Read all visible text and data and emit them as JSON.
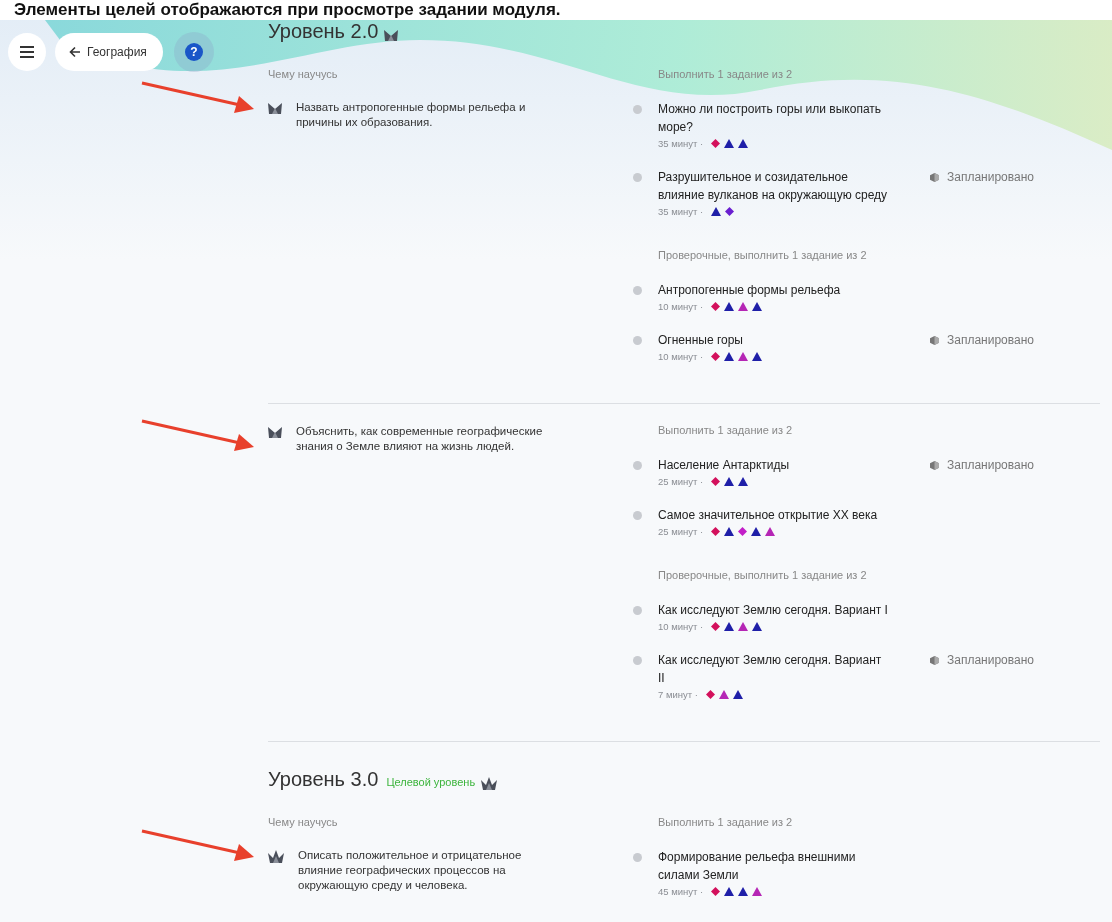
{
  "caption": "Элементы целей отображаются при просмотре задании модуля.",
  "nav": {
    "back_label": "География",
    "help_label": "?"
  },
  "levels": [
    {
      "title": "Уровень 2.0",
      "kind": "two-peak",
      "goals_heading": "Чему научусь",
      "goals": [
        {
          "text": "Назвать антропогенные формы рельефа и причины их образования.",
          "arrowed": true,
          "groups": [
            {
              "heading": "Выполнить 1 задание из 2",
              "tasks": [
                {
                  "title": "Можно ли построить горы или выкопать море?",
                  "duration": "35 минут ·",
                  "marks": [
                    {
                      "kind": "diamond",
                      "color": "#d3105c"
                    },
                    {
                      "kind": "triangle",
                      "color": "#1f1fa8"
                    },
                    {
                      "kind": "triangle",
                      "color": "#1f1fa8"
                    }
                  ]
                },
                {
                  "title": "Разрушительное и созидательное влияние вулканов на окружающую среду",
                  "duration": "35 минут ·",
                  "status": "Запланировано",
                  "marks": [
                    {
                      "kind": "triangle",
                      "color": "#1f1fa8"
                    },
                    {
                      "kind": "diamond",
                      "color": "#6a1fd0"
                    }
                  ]
                }
              ]
            },
            {
              "heading": "Проверочные, выполнить 1 задание из 2",
              "tasks": [
                {
                  "title": "Антропогенные формы рельефа",
                  "duration": "10 минут ·",
                  "marks": [
                    {
                      "kind": "diamond",
                      "color": "#d3105c"
                    },
                    {
                      "kind": "triangle",
                      "color": "#1f1fa8"
                    },
                    {
                      "kind": "triangle",
                      "color": "#b526b5"
                    },
                    {
                      "kind": "triangle",
                      "color": "#1f1fa8"
                    }
                  ]
                },
                {
                  "title": "Огненные горы",
                  "duration": "10 минут ·",
                  "status": "Запланировано",
                  "marks": [
                    {
                      "kind": "diamond",
                      "color": "#d3105c"
                    },
                    {
                      "kind": "triangle",
                      "color": "#1f1fa8"
                    },
                    {
                      "kind": "triangle",
                      "color": "#b526b5"
                    },
                    {
                      "kind": "triangle",
                      "color": "#1f1fa8"
                    }
                  ]
                }
              ]
            }
          ]
        },
        {
          "text": "Объяснить, как современные географические знания о Земле влияют на жизнь людей.",
          "arrowed": true,
          "groups": [
            {
              "heading": "Выполнить 1 задание из 2",
              "tasks": [
                {
                  "title": "Население Антарктиды",
                  "duration": "25 минут ·",
                  "status": "Запланировано",
                  "marks": [
                    {
                      "kind": "diamond",
                      "color": "#d3105c"
                    },
                    {
                      "kind": "triangle",
                      "color": "#1f1fa8"
                    },
                    {
                      "kind": "triangle",
                      "color": "#1f1fa8"
                    }
                  ]
                },
                {
                  "title": "Самое значительное открытие XX века",
                  "duration": "25 минут ·",
                  "marks": [
                    {
                      "kind": "diamond",
                      "color": "#d3105c"
                    },
                    {
                      "kind": "triangle",
                      "color": "#1f1fa8"
                    },
                    {
                      "kind": "diamond",
                      "color": "#c21fc8"
                    },
                    {
                      "kind": "triangle",
                      "color": "#1f1fa8"
                    },
                    {
                      "kind": "triangle",
                      "color": "#b526b5"
                    }
                  ]
                }
              ]
            },
            {
              "heading": "Проверочные, выполнить 1 задание из 2",
              "tasks": [
                {
                  "title": "Как исследуют Землю сегодня. Вариант I",
                  "duration": "10 минут ·",
                  "marks": [
                    {
                      "kind": "diamond",
                      "color": "#d3105c"
                    },
                    {
                      "kind": "triangle",
                      "color": "#1f1fa8"
                    },
                    {
                      "kind": "triangle",
                      "color": "#b526b5"
                    },
                    {
                      "kind": "triangle",
                      "color": "#1f1fa8"
                    }
                  ]
                },
                {
                  "title": "Как исследуют Землю сегодня. Вариант II",
                  "duration": "7 минут ·",
                  "status": "Запланировано",
                  "marks": [
                    {
                      "kind": "diamond",
                      "color": "#d3105c"
                    },
                    {
                      "kind": "triangle",
                      "color": "#b526b5"
                    },
                    {
                      "kind": "triangle",
                      "color": "#1f1fa8"
                    }
                  ]
                }
              ]
            }
          ]
        }
      ]
    },
    {
      "title": "Уровень 3.0",
      "target_label": "Целевой уровень",
      "kind": "three-peak",
      "goals_heading": "Чему научусь",
      "goals": [
        {
          "text": "Описать положительное и отрицательное влияние географических процессов на окружающую среду и человека.",
          "arrowed": true,
          "groups": [
            {
              "heading": "Выполнить 1 задание из 2",
              "tasks": [
                {
                  "title": "Формирование рельефа внешними силами Земли",
                  "duration": "45 минут ·",
                  "marks": [
                    {
                      "kind": "diamond",
                      "color": "#d3105c"
                    },
                    {
                      "kind": "triangle",
                      "color": "#1f1fa8"
                    },
                    {
                      "kind": "triangle",
                      "color": "#1f1fa8"
                    },
                    {
                      "kind": "triangle",
                      "color": "#b526b5"
                    }
                  ]
                }
              ]
            }
          ]
        }
      ]
    }
  ]
}
